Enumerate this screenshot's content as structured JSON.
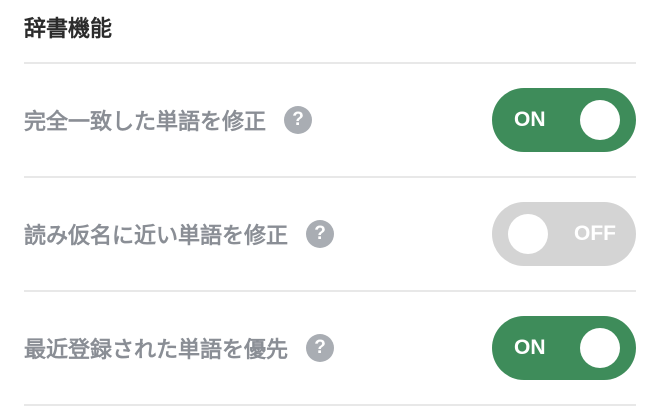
{
  "section": {
    "title": "辞書機能"
  },
  "settings": [
    {
      "label": "完全一致した単語を修正",
      "help_icon": "?",
      "toggle_state": "ON",
      "enabled": true
    },
    {
      "label": "読み仮名に近い単語を修正",
      "help_icon": "?",
      "toggle_state": "OFF",
      "enabled": false
    },
    {
      "label": "最近登録された単語を優先",
      "help_icon": "?",
      "toggle_state": "ON",
      "enabled": true
    }
  ],
  "colors": {
    "toggle_on": "#3e8c5a",
    "toggle_off": "#d4d4d4",
    "label_text": "#8a8e95",
    "title_text": "#2b2b2b",
    "help_icon_bg": "#a9adb3",
    "divider": "#e8e8e8"
  },
  "icons": {
    "help": "question-circle-icon"
  }
}
